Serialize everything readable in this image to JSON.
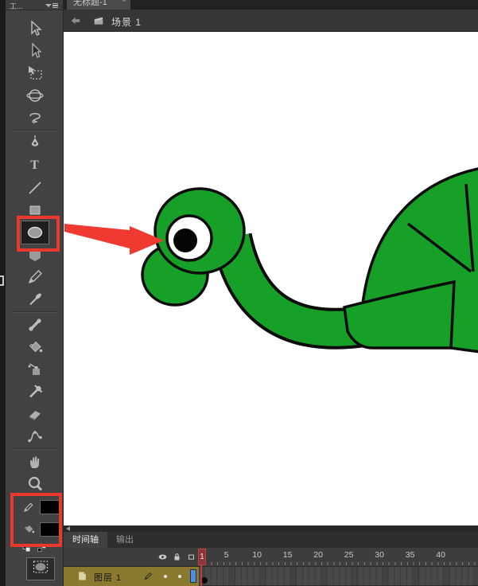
{
  "document_tab": {
    "title": "无标题-1",
    "close_label": "×"
  },
  "edit_bar": {
    "scene_label": "场景 1"
  },
  "tools_panel": {
    "header_label": "工...",
    "tools": [
      {
        "id": "selection-tool"
      },
      {
        "id": "subselection-tool"
      },
      {
        "id": "free-transform-tool"
      },
      {
        "id": "3d-rotation-tool"
      },
      {
        "id": "lasso-tool"
      },
      {
        "divider": true
      },
      {
        "id": "pen-tool"
      },
      {
        "id": "text-tool",
        "glyph": "T"
      },
      {
        "id": "line-tool"
      },
      {
        "id": "rectangle-tool"
      },
      {
        "id": "oval-tool",
        "selected": true,
        "highlighted": true
      },
      {
        "id": "polystar-tool"
      },
      {
        "id": "pencil-tool"
      },
      {
        "id": "brush-tool"
      },
      {
        "divider": true
      },
      {
        "id": "bone-tool"
      },
      {
        "id": "paint-bucket-tool"
      },
      {
        "id": "ink-bottle-tool"
      },
      {
        "id": "eyedropper-tool"
      },
      {
        "id": "eraser-tool"
      },
      {
        "id": "deco-tool"
      },
      {
        "divider": true
      },
      {
        "id": "hand-tool"
      },
      {
        "id": "zoom-tool"
      }
    ],
    "stroke_color": "#000000",
    "fill_color": "#000000"
  },
  "annotations": {
    "highlight_color": "#ea382e",
    "boxes": [
      "oval-tool",
      "color-swatches"
    ],
    "arrow": {
      "color": "#ee3a30",
      "points_to": "turtle-eye"
    }
  },
  "stage": {
    "figure": "turtle-head-neck-shell",
    "fill_color": "#16a028",
    "outline_color": "#0c0c0c",
    "eye_white": "#ffffff",
    "pupil_color": "#000000"
  },
  "timeline": {
    "panel_tabs": [
      {
        "label": "时间轴",
        "active": true
      },
      {
        "label": "输出",
        "active": false
      }
    ],
    "column_icons": [
      "eye-icon",
      "lock-icon",
      "outline-icon"
    ],
    "ruler_numbers": [
      1,
      5,
      10,
      15,
      20,
      25,
      30,
      35,
      40
    ],
    "current_frame": 1,
    "layer": {
      "name": "图层 1",
      "selected": true,
      "outline_swatch": "#4f8fdd"
    }
  }
}
